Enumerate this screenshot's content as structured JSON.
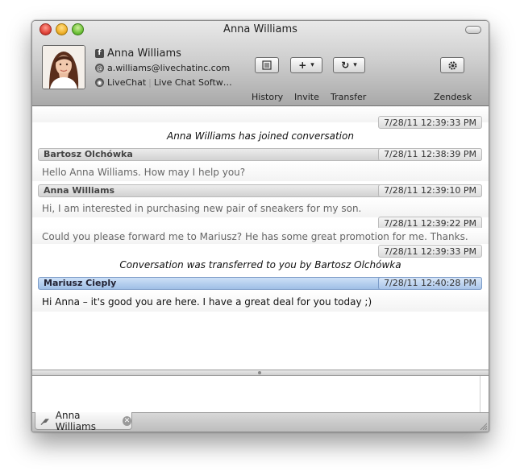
{
  "window": {
    "title": "Anna Williams"
  },
  "contact": {
    "name": "Anna Williams",
    "email": "a.williams@livechatinc.com",
    "source": "LiveChat",
    "site": "Live Chat Softw…"
  },
  "toolbar": {
    "history_label": "History",
    "invite_label": "Invite",
    "transfer_label": "Transfer",
    "zendesk_label": "Zendesk",
    "invite_glyph": "+",
    "transfer_glyph": "↻",
    "dropdown_glyph": "▾"
  },
  "chat": {
    "items": [
      {
        "type": "timestamp",
        "time": "7/28/11 12:39:33 PM"
      },
      {
        "type": "system",
        "text": "Anna Williams has joined conversation"
      },
      {
        "type": "header",
        "author": "Bartosz Olchówka",
        "time": "7/28/11 12:38:39 PM"
      },
      {
        "type": "message",
        "text": "Hello Anna Williams. How may I help you?"
      },
      {
        "type": "header",
        "author": "Anna Williams",
        "time": "7/28/11 12:39:10 PM"
      },
      {
        "type": "message",
        "text": "Hi, I am interested in purchasing new pair of sneakers for my son."
      },
      {
        "type": "timestamp",
        "time": "7/28/11 12:39:22 PM"
      },
      {
        "type": "message",
        "text": "Could you please forward me to Mariusz? He has some great promotion for me. Thanks."
      },
      {
        "type": "timestamp",
        "time": "7/28/11 12:39:33 PM"
      },
      {
        "type": "system",
        "text": "Conversation was transferred to you by Bartosz Olchówka"
      },
      {
        "type": "header",
        "author": "Mariusz Cieply",
        "time": "7/28/11 12:40:28 PM",
        "active": true
      },
      {
        "type": "message",
        "text": "Hi Anna – it's good you are here. I have a great deal for you today ;)",
        "active": true
      }
    ]
  },
  "tabs": [
    {
      "label": "Anna Williams"
    }
  ],
  "colors": {
    "active_header": "#9fbfe6",
    "toolbar": "#a9a9a9"
  }
}
